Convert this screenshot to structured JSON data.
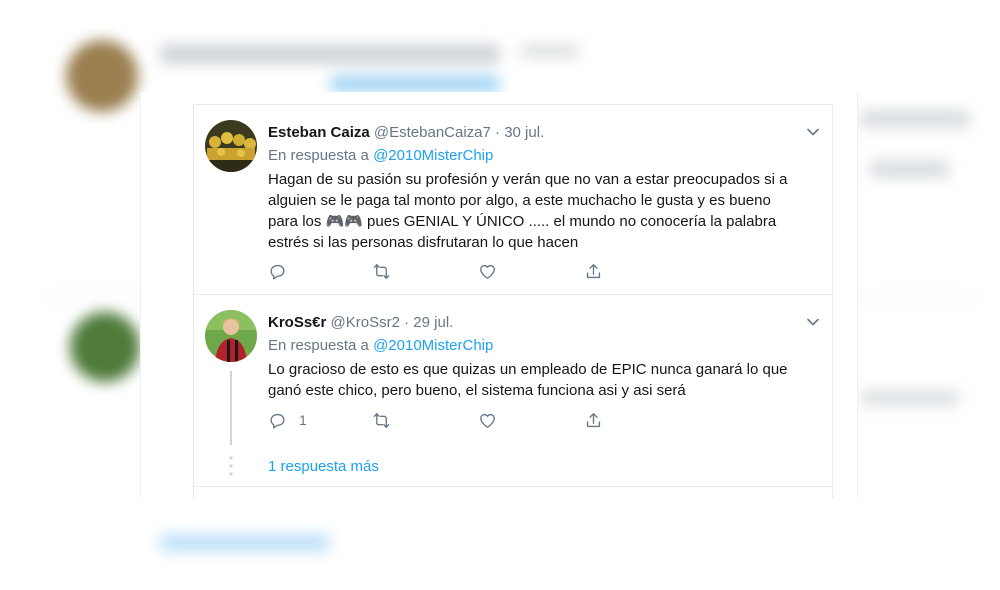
{
  "colors": {
    "accent": "#1da1f2",
    "text_primary": "#14171a",
    "text_secondary": "#657786",
    "divider": "#e6ecf0"
  },
  "tweets": [
    {
      "name": "Esteban Caiza",
      "handle": "@EstebanCaiza7",
      "separator": "·",
      "date": "30 jul.",
      "reply_prefix": "En respuesta a",
      "reply_to": "@2010MisterChip",
      "lines": [
        "Hagan de su pasión su profesión y verán que no van a estar preocupados si a",
        "alguien se le paga tal monto por algo, a este muchacho le gusta y es bueno",
        "para los 🎮🎮 pues GENIAL Y ÚNICO ..... el mundo no conocería la palabra",
        "estrés si las personas disfrutaran lo que hacen"
      ],
      "reply_count": "",
      "icons": [
        "reply-icon",
        "retweet-icon",
        "like-icon",
        "share-icon",
        "chevron-down-icon"
      ]
    },
    {
      "name": "KroSs€r",
      "handle": "@KroSsr2",
      "separator": "·",
      "date": "29 jul.",
      "reply_prefix": "En respuesta a",
      "reply_to": "@2010MisterChip",
      "lines": [
        "Lo gracioso de esto es que quizas un empleado de EPIC nunca ganará lo que",
        "ganó este chico, pero bueno, el sistema funciona asi y asi será"
      ],
      "reply_count": "1",
      "icons": [
        "reply-icon",
        "retweet-icon",
        "like-icon",
        "share-icon",
        "chevron-down-icon"
      ]
    }
  ],
  "more_replies": "1 respuesta más"
}
